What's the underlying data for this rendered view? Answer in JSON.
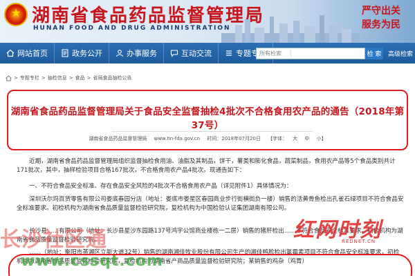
{
  "header": {
    "title": "湖南省食品药品监督管理局",
    "subtitle": "HUNAN FOOD AND DRUG ADMINISTRATION",
    "slogan_line1": "严守出关",
    "slogan_line2": "服务为民"
  },
  "nav": {
    "items": [
      {
        "label": "网站首页",
        "icon": "home-icon"
      },
      {
        "label": "政务公开",
        "icon": "document-icon"
      },
      {
        "label": "办事服务",
        "icon": "person-icon"
      },
      {
        "label": "互动交流",
        "icon": "chat-icon"
      },
      {
        "label": "专题专栏",
        "icon": "list-icon"
      }
    ],
    "search": {
      "scope": "所有检索",
      "placeholder": "",
      "button": "检 索",
      "advanced": "高级检索"
    }
  },
  "breadcrumb": [
    "专题专栏",
    "抽检信息",
    "食品",
    "省局食品抽检公告"
  ],
  "article": {
    "title": "湖南省食品药品监督管理局关于食品安全监督抽检4批次不合格食用农产品的通告（2018年第37号）",
    "source": "湖南省食品药品监督管理局",
    "website": "www.hn-fda.gov.cn",
    "date": "时间：2018年07月20日",
    "font_label": "【字体：",
    "font_big": "大",
    "font_mid": "中",
    "font_small": "小】",
    "paragraphs": [
      "近期，湖南省食品药品监督管理局组织监督抽检食用油、油脂及其制品，饼干，薯类和膨化食品，蔬菜制品，食用农产品等5个食品类别共计171批次，其中，抽样检验项目合格167批次，不合格食用农产品4批次。现通告如下：",
      "一、不符合食品安全标准、存在食品安全风险的4批次不合格食用农产品（详见附件1）具体情况为：",
      "深圳沃尔玛百货零售有限公司娄底春园分店（地址：娄底市娄星区春园商业步行街横街负一楼）销售的活黄骨鱼检出孔雀石绿项目不符合食品安全标准要求。初检机构为湖南省食品质量监督检验研究院，复检机构为中国检验认证集团湖南有限公司。",
      "长沙县……有限公司（地址：长沙县星沙东园路137号鸿宇公馆商业楼栋一二层）销售的猪肝检出……不符合食品安全标准要求。初检机构为湖南省食品质量监督检验研究院。",
      "……（地址：衡阳市蒸湘区立新大道32号）销售的湖南湘佳牧业股份有限公司生产的湘佳鸭胗检出氯霉素项目不符合食品安全标准要求，初检机构为湖南省食品质量监督检验研究院，复检机构为湖南省产商品质量监督检验研究院；某销售的鸡杂（鸡胃）"
    ]
  },
  "watermarks": {
    "rednet": "红网时刻",
    "rednet_sub": "REDNET.CN",
    "site": "长沙社区通",
    "url": "www.cssqt.com"
  },
  "colors": {
    "brand_red": "#c8161d",
    "nav_blue": "#1d5a9c",
    "highlight_border": "#e01b1b"
  }
}
